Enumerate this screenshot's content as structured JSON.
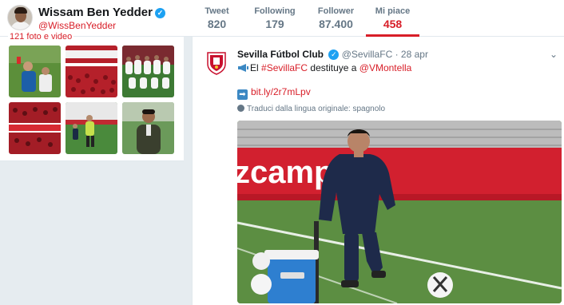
{
  "profile": {
    "name": "Wissam Ben Yedder",
    "handle": "@WissBenYedder",
    "verified_icon": "verified-badge-icon",
    "media_count": "121 foto e video"
  },
  "stats": [
    {
      "label": "Tweet",
      "value": "820",
      "active": false
    },
    {
      "label": "Following",
      "value": "179",
      "active": false
    },
    {
      "label": "Follower",
      "value": "87.400",
      "active": false
    },
    {
      "label": "Mi piace",
      "value": "458",
      "active": true
    }
  ],
  "tweet": {
    "author": "Sevilla Fútbol Club",
    "handle": "@SevillaFC",
    "separator": "·",
    "date": "28 apr",
    "text_prefix": "El",
    "hashtag": "#SevillaFC",
    "text_mid": "destituye a",
    "mention": "@VMontella",
    "link": "bit.ly/2r7mLpv",
    "translation_note": "Traduci dalla lingua originale: spagnolo",
    "photo_banner": "zcampo"
  },
  "colors": {
    "accent": "#d81e28",
    "verified": "#1da1f2",
    "muted": "#657786",
    "background": "#e6ecf0"
  }
}
